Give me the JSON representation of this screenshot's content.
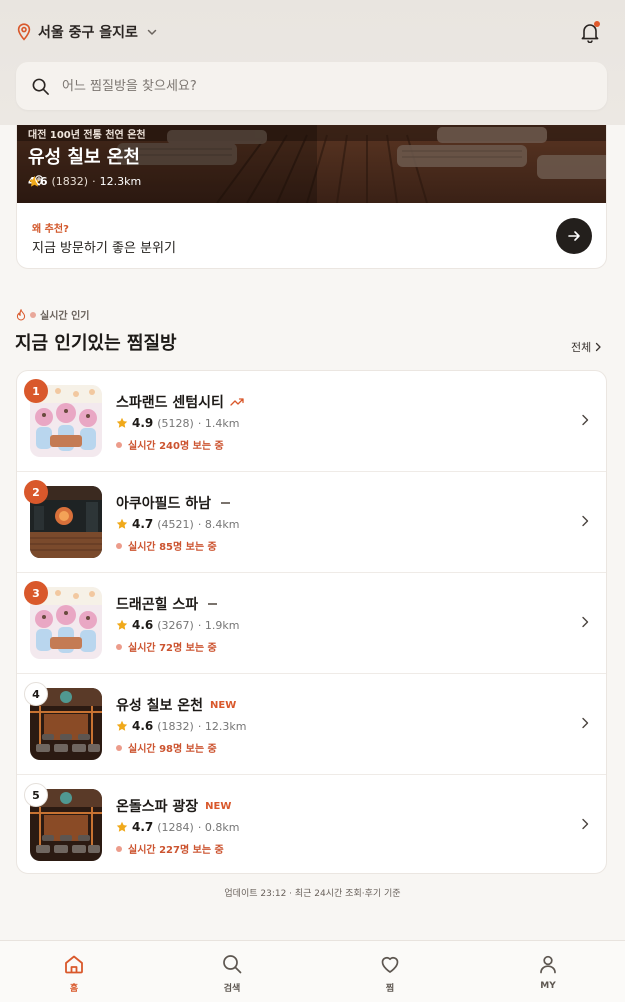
{
  "location": {
    "label": "서울 중구 을지로"
  },
  "search": {
    "placeholder": "어느 찜질방을 찾으세요?"
  },
  "hero": {
    "subtitle": "대전 100년 전통 천연 온천",
    "title": "유성 칠보 온천",
    "rating": "4.6",
    "reviews": "(1832)",
    "separator": "·",
    "distance": "12.3km",
    "why_label": "왜 추천?",
    "why_text": "지금 방문하기 좋은 분위기"
  },
  "section": {
    "tag": "실시간 인기",
    "title": "지금 인기있는 찜질방",
    "see_all": "전체"
  },
  "ranking": [
    {
      "rank": "1",
      "name": "스파랜드 센텀시티",
      "trend": "up",
      "rating": "4.9",
      "reviews": "(5128)",
      "distance": "· 1.4km",
      "live": "실시간 240명 보는 중"
    },
    {
      "rank": "2",
      "name": "아쿠아필드 하남",
      "trend": "flat",
      "rating": "4.7",
      "reviews": "(4521)",
      "distance": "· 8.4km",
      "live": "실시간 85명 보는 중"
    },
    {
      "rank": "3",
      "name": "드래곤힐 스파",
      "trend": "flat",
      "rating": "4.6",
      "reviews": "(3267)",
      "distance": "· 1.9km",
      "live": "실시간 72명 보는 중"
    },
    {
      "rank": "4",
      "name": "유성 칠보 온천",
      "trend": "new",
      "new_label": "NEW",
      "rating": "4.6",
      "reviews": "(1832)",
      "distance": "· 12.3km",
      "live": "실시간 98명 보는 중"
    },
    {
      "rank": "5",
      "name": "온돌스파 광장",
      "trend": "new",
      "new_label": "NEW",
      "rating": "4.7",
      "reviews": "(1284)",
      "distance": "· 0.8km",
      "live": "실시간 227명 보는 중"
    }
  ],
  "footnote": "업데이트 23:12 · 최근 24시간 조회·후기 기준",
  "tabs": [
    {
      "label": "홈",
      "icon": "home-icon",
      "active": true
    },
    {
      "label": "검색",
      "icon": "search-icon",
      "active": false
    },
    {
      "label": "찜",
      "icon": "heart-icon",
      "active": false
    },
    {
      "label": "MY",
      "icon": "user-icon",
      "active": false
    }
  ],
  "colors": {
    "accent": "#d9582b",
    "dark": "#231f1c",
    "star": "#f0a91b"
  }
}
